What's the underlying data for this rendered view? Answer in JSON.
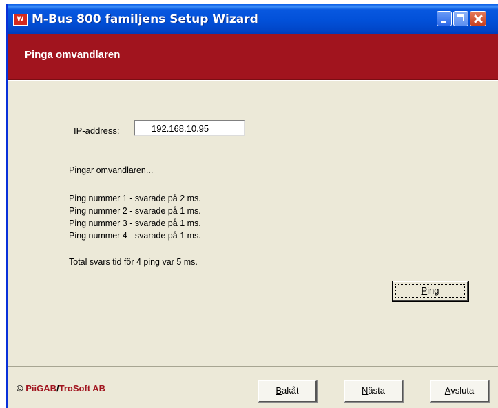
{
  "window": {
    "title": "M-Bus 800 familjens Setup Wizard",
    "icon_glyph": "W",
    "icon": "app-icon"
  },
  "header": {
    "title": "Pinga omvandlaren"
  },
  "form": {
    "ip_label": "IP-address:",
    "ip_value": "192.168.10.95"
  },
  "log": {
    "status": "Pingar omvandlaren...",
    "lines": [
      "Ping nummer 1 - svarade på 2 ms.",
      "Ping nummer 2 - svarade på 1 ms.",
      "Ping nummer 3 - svarade på 1 ms.",
      "Ping nummer 4 - svarade på 1 ms."
    ],
    "total": "Total svars tid för 4 ping var 5 ms."
  },
  "ping_button": {
    "mnemonic": "P",
    "rest": "ing"
  },
  "footer": {
    "copyright_symbol": "©",
    "brand_a": "PiiGAB",
    "slash": "/",
    "brand_b": "TroSoft AB",
    "back": {
      "mnemonic": "B",
      "rest": "akåt"
    },
    "next": {
      "mnemonic": "N",
      "rest": "ästa"
    },
    "exit": {
      "mnemonic": "A",
      "rest": "vsluta"
    }
  },
  "colors": {
    "header_red": "#a1141e",
    "titlebar_blue": "#0250d8",
    "face": "#ece9d8"
  }
}
